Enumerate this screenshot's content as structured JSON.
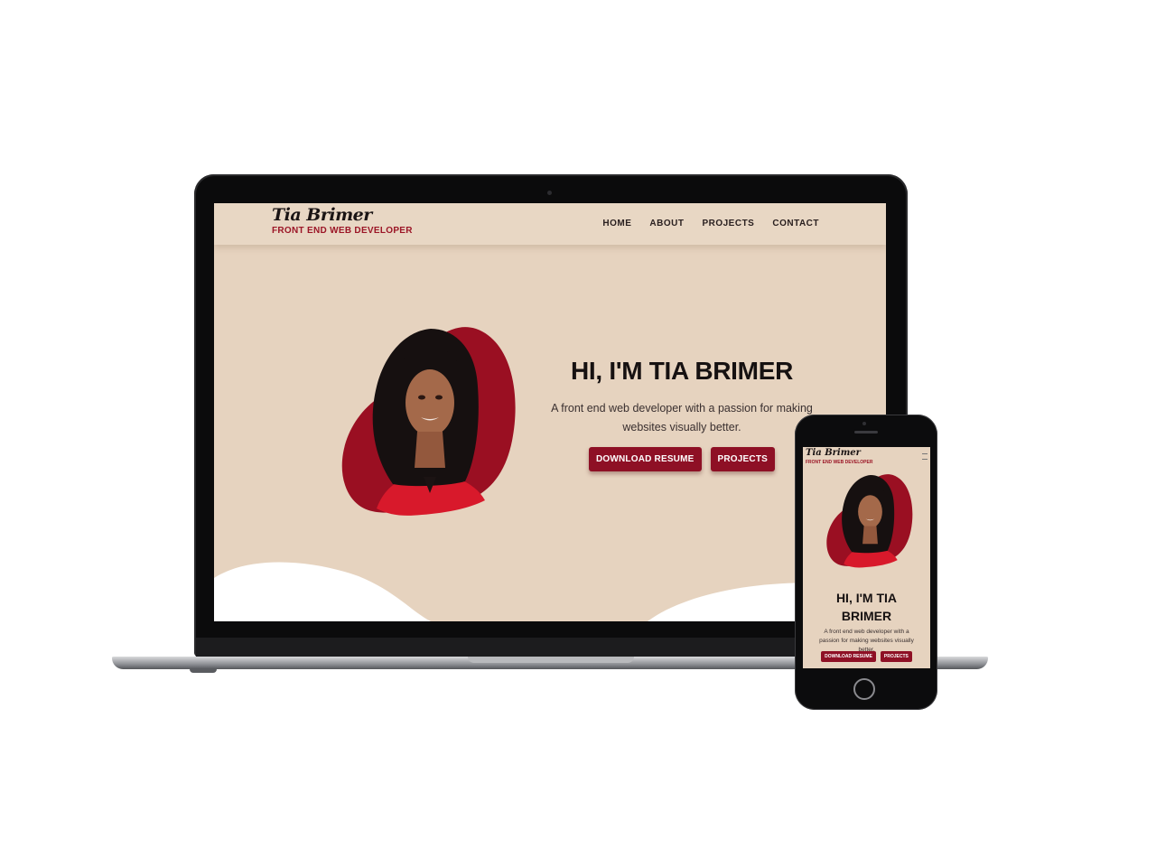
{
  "site": {
    "name": "Tia Brimer",
    "tagline": "FRONT END WEB DEVELOPER",
    "nav": [
      "HOME",
      "ABOUT",
      "PROJECTS",
      "CONTACT"
    ],
    "hero": {
      "title": "HI, I'M TIA BRIMER",
      "description": "A front end web developer with a passion for making websites visually better.",
      "buttons": [
        "DOWNLOAD RESUME",
        "PROJECTS"
      ]
    }
  },
  "mobile": {
    "title_line1": "HI, I'M TIA",
    "title_line2": "BRIMER"
  },
  "colors": {
    "background": "#e6d3bf",
    "accent": "#8e1025",
    "tagline": "#9b1526",
    "text": "#161111"
  },
  "icons": {
    "mobile_menu": "hamburger-icon"
  }
}
